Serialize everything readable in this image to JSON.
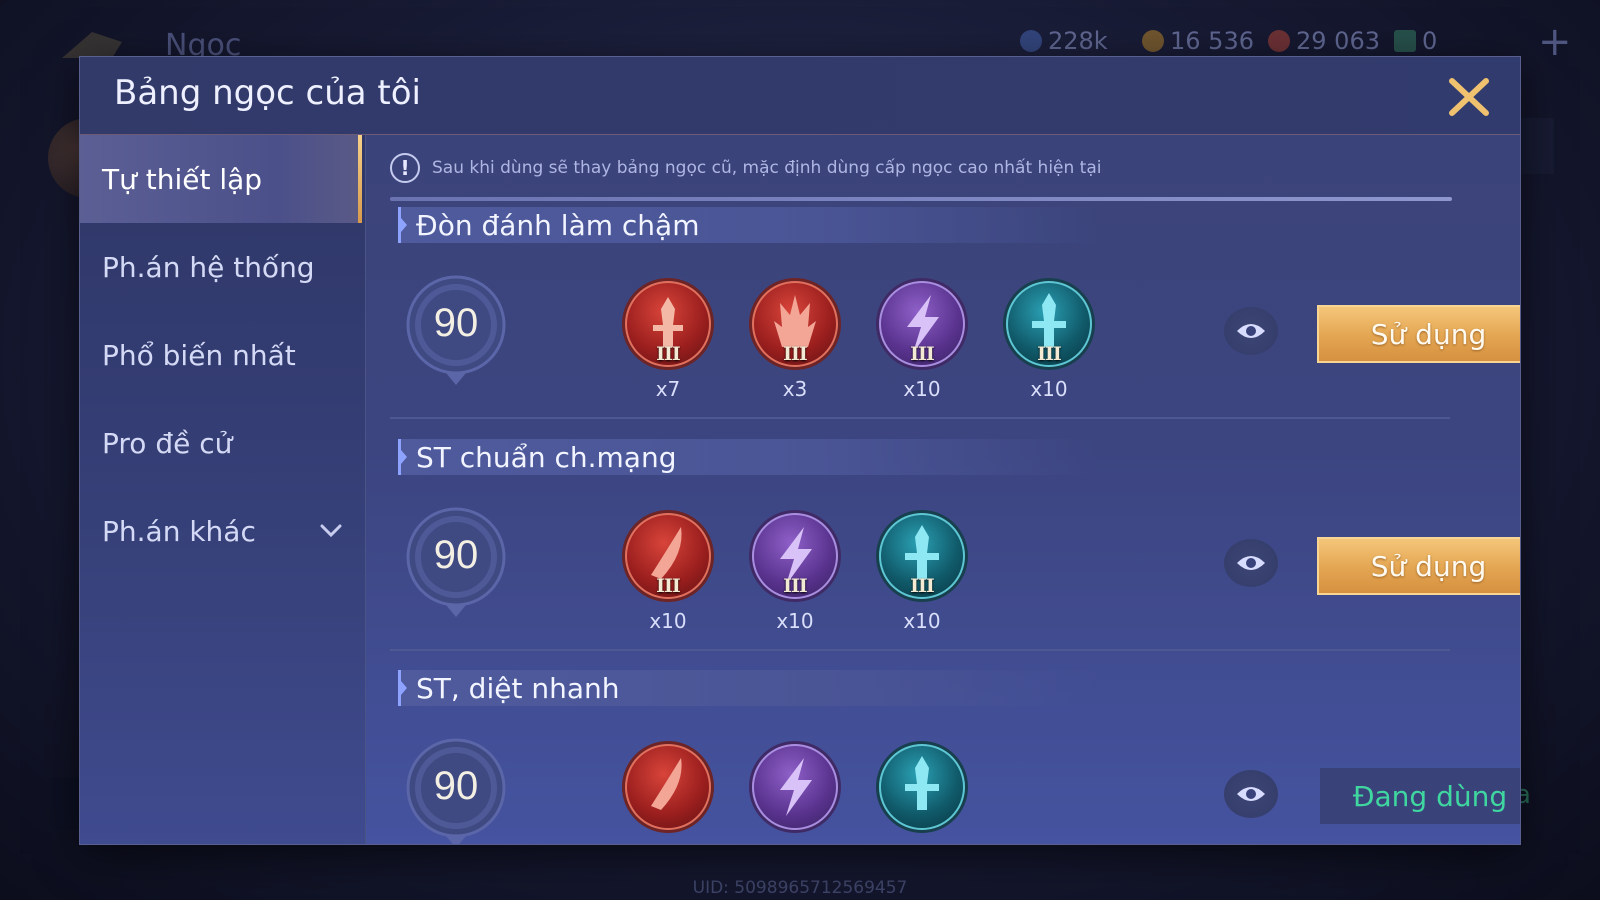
{
  "background": {
    "title": "Ngọc",
    "currencies": [
      {
        "icon": "diamond-icon",
        "value": "228k",
        "color": "#4a6bc0"
      },
      {
        "icon": "gold-coin-icon",
        "value": "16 536",
        "color": "#c8902a"
      },
      {
        "icon": "red-voucher-icon",
        "value": "29 063",
        "color": "#c2493a"
      },
      {
        "icon": "green-card-icon",
        "value": "0",
        "color": "#3a8a6a"
      }
    ],
    "add_label": "+",
    "right_text": "a",
    "uid": "UID: 5098965712569457"
  },
  "modal": {
    "title": "Bảng ngọc của tôi",
    "close_icon": "close-icon"
  },
  "sidebar": {
    "items": [
      {
        "label": "Tự thiết lập",
        "active": true
      },
      {
        "label": "Ph.án hệ thống",
        "active": false
      },
      {
        "label": "Phổ biến nhất",
        "active": false
      },
      {
        "label": "Pro đề cử",
        "active": false
      },
      {
        "label": "Ph.án khác",
        "active": false,
        "has_dropdown": true
      }
    ]
  },
  "notice": {
    "text": "Sau khi dùng sẽ thay bảng ngọc cũ, mặc định dùng cấp ngọc cao nhất hiện tại"
  },
  "sections": [
    {
      "title": "Đòn đánh làm chậm",
      "level": "90",
      "gems": [
        {
          "color": "red",
          "icon": "sword-icon",
          "tier": "III",
          "count": "x7"
        },
        {
          "color": "red",
          "icon": "flame-icon",
          "tier": "III",
          "count": "x3"
        },
        {
          "color": "purple",
          "icon": "lightning-icon",
          "tier": "III",
          "count": "x10"
        },
        {
          "color": "teal",
          "icon": "sword-icon",
          "tier": "III",
          "count": "x10"
        }
      ],
      "action": {
        "label": "Sử dụng",
        "state": "use"
      }
    },
    {
      "title": "ST chuẩn ch.mạng",
      "level": "90",
      "gems": [
        {
          "color": "red",
          "icon": "blade-icon",
          "tier": "III",
          "count": "x10"
        },
        {
          "color": "purple",
          "icon": "lightning-icon",
          "tier": "III",
          "count": "x10"
        },
        {
          "color": "teal",
          "icon": "sword-icon",
          "tier": "III",
          "count": "x10"
        }
      ],
      "action": {
        "label": "Sử dụng",
        "state": "use"
      }
    },
    {
      "title": "ST, diệt nhanh",
      "level": "90",
      "gems": [
        {
          "color": "red",
          "icon": "blade-icon"
        },
        {
          "color": "purple",
          "icon": "lightning-icon"
        },
        {
          "color": "teal",
          "icon": "sword-icon"
        }
      ],
      "action": {
        "label": "Đang dùng",
        "state": "using"
      }
    }
  ]
}
